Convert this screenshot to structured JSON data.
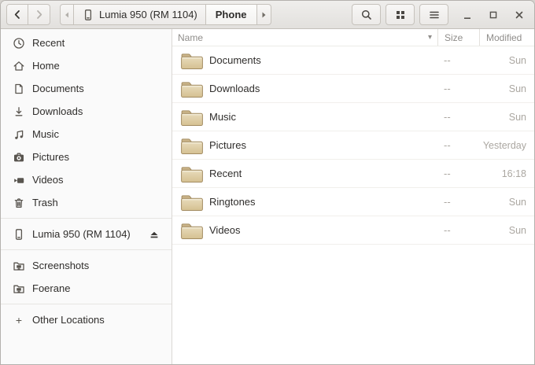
{
  "toolbar": {
    "path": {
      "device_label": "Lumia 950 (RM 1104)",
      "current_label": "Phone"
    }
  },
  "icons": {
    "sort_arrow": "▾",
    "plus": "+"
  },
  "sidebar": {
    "items": [
      {
        "label": "Recent",
        "icon": "clock-icon"
      },
      {
        "label": "Home",
        "icon": "home-icon"
      },
      {
        "label": "Documents",
        "icon": "document-icon"
      },
      {
        "label": "Downloads",
        "icon": "download-icon"
      },
      {
        "label": "Music",
        "icon": "music-icon"
      },
      {
        "label": "Pictures",
        "icon": "camera-icon"
      },
      {
        "label": "Videos",
        "icon": "video-icon"
      },
      {
        "label": "Trash",
        "icon": "trash-icon"
      }
    ],
    "device": {
      "label": "Lumia 950 (RM 1104)"
    },
    "bookmarks": [
      {
        "label": "Screenshots",
        "icon": "remote-folder-icon"
      },
      {
        "label": "Foerane",
        "icon": "remote-folder-icon"
      }
    ],
    "other_locations": {
      "label": "Other Locations"
    }
  },
  "list": {
    "columns": {
      "name": "Name",
      "size": "Size",
      "modified": "Modified"
    },
    "rows": [
      {
        "name": "Documents",
        "size": "--",
        "modified": "Sun"
      },
      {
        "name": "Downloads",
        "size": "--",
        "modified": "Sun"
      },
      {
        "name": "Music",
        "size": "--",
        "modified": "Sun"
      },
      {
        "name": "Pictures",
        "size": "--",
        "modified": "Yesterday"
      },
      {
        "name": "Recent",
        "size": "--",
        "modified": "16:18"
      },
      {
        "name": "Ringtones",
        "size": "--",
        "modified": "Sun"
      },
      {
        "name": "Videos",
        "size": "--",
        "modified": "Sun"
      }
    ]
  },
  "colors": {
    "folder_body": "#dcc9a0",
    "folder_border": "#a38c62",
    "headerbar_bg": "#e9e7e4",
    "sidebar_bg": "#fafafa",
    "muted_text": "#aba7a1"
  }
}
